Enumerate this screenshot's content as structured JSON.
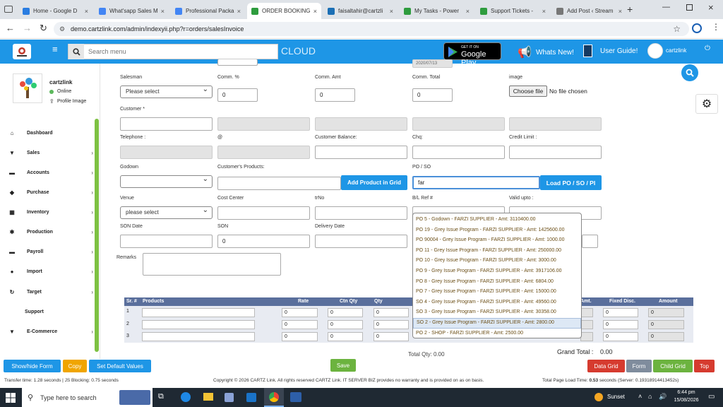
{
  "browser": {
    "tabs": [
      {
        "label": "Home - Google D",
        "color": "#2a7de1"
      },
      {
        "label": "What'sapp Sales M",
        "color": "#4285f4"
      },
      {
        "label": "Professional Packa",
        "color": "#4285f4"
      },
      {
        "label": "ORDER BOOKING",
        "color": "#2e9c3e"
      },
      {
        "label": "faisaltahir@cartzli",
        "color": "#1b6fb5"
      },
      {
        "label": "My Tasks - Power",
        "color": "#2e9c3e"
      },
      {
        "label": "Support Tickets -",
        "color": "#2e9c3e"
      },
      {
        "label": "Add Post ‹ Stream",
        "color": "#555"
      }
    ],
    "url": "demo.cartzlink.com/admin/indexyii.php?r=orders/salesInvoice"
  },
  "header": {
    "search_placeholder": "Search menu",
    "cloud_label": "CLOUD",
    "google_play_small": "GET IT ON",
    "google_play_big": "Google Play",
    "whats_new": "Whats New!",
    "user_guide": "User Guide!",
    "user_name": "cartzlink"
  },
  "sidebar": {
    "user_name": "cartzlink",
    "status": "Online",
    "profile_image": "Profile Image",
    "items": [
      {
        "label": "Dashboard",
        "icon": "home-icon",
        "glyph": "⌂",
        "chevron": false
      },
      {
        "label": "Sales",
        "icon": "cart-icon",
        "glyph": "🛒",
        "chevron": true
      },
      {
        "label": "Accounts",
        "icon": "bank-icon",
        "glyph": "▬",
        "chevron": true
      },
      {
        "label": "Purchase",
        "icon": "tag-icon",
        "glyph": "◆",
        "chevron": true
      },
      {
        "label": "Inventory",
        "icon": "grid-icon",
        "glyph": "▦",
        "chevron": true
      },
      {
        "label": "Production",
        "icon": "gear-icon",
        "glyph": "✱",
        "chevron": true
      },
      {
        "label": "Payroll",
        "icon": "bank-icon",
        "glyph": "▬",
        "chevron": true
      },
      {
        "label": "Import",
        "icon": "user-icon",
        "glyph": "●",
        "chevron": true
      },
      {
        "label": "Target",
        "icon": "refresh-icon",
        "glyph": "↻",
        "chevron": true
      },
      {
        "label": "Support",
        "icon": "",
        "glyph": "",
        "chevron": false
      },
      {
        "label": "E-Commerce",
        "icon": "cart-icon",
        "glyph": "🛒",
        "chevron": true
      }
    ]
  },
  "form": {
    "partial_date": "2020/07/13",
    "salesman_label": "Salesman",
    "salesman_value": "Please select",
    "comm_pct_label": "Comm. %",
    "comm_pct_value": "0",
    "comm_amt_label": "Comm. Amt",
    "comm_amt_value": "0",
    "comm_total_label": "Comm. Total",
    "comm_total_value": "0",
    "image_label": "image",
    "choose_file": "Choose file",
    "no_file": "No file chosen",
    "customer_label": "Customer *",
    "telephone_label": "Telephone :",
    "at_label": "@",
    "customer_balance_label": "Customer Balance:",
    "chq_label": "Chq:",
    "credit_limit_label": "Credit Limit :",
    "godown_label": "Godown",
    "customers_products_label": "Customer's Products:",
    "add_product_btn": "Add Product in Grid",
    "po_so_label": "PO / SO",
    "po_so_value": "far",
    "load_po_btn": "Load PO / SO / PI",
    "venue_label": "Venue",
    "venue_value": "please select",
    "cost_center_label": "Cost Center",
    "trno_label": "trNo",
    "bl_ref_label": "B/L Ref #",
    "valid_upto_label": "Valid upto :",
    "son_date_label": "SON Date",
    "son_label": "SON",
    "son_value": "0",
    "delivery_date_label": "Delivery Date",
    "remarks_label": "Remarks"
  },
  "po_dropdown": [
    "PO 5 - Godown - FARZI SUPPLIER - Amt: 3110400.00",
    "PO 19 - Grey Issue Program - FARZI SUPPLIER - Amt: 1425600.00",
    "PO 90004 - Grey Issue Program - FARZI SUPPLIER - Amt: 1000.00",
    "PO 11 - Grey Issue Program - FARZI SUPPLIER - Amt: 250000.00",
    "PO 10 - Grey Issue Program - FARZI SUPPLIER - Amt: 3000.00",
    "PO 9 - Grey Issue Program - FARZI SUPPLIER - Amt: 3917106.00",
    "PO 8 - Grey Issue Program - FARZI SUPPLIER - Amt: 6804.00",
    "PO 7 - Grey Issue Program - FARZI SUPPLIER - Amt: 15000.00",
    "SO 4 - Grey Issue Program - FARZI SUPPLIER - Amt: 49560.00",
    "SO 3 - Grey Issue Program - FARZI SUPPLIER - Amt: 30358.00",
    "SO 2 - Grey Issue Program - FARZI SUPPLIER - Amt: 2800.00",
    "PO 2 - SHOP - FARZI SUPPLIER - Amt: 2500.00"
  ],
  "po_dropdown_highlight": 10,
  "grid": {
    "headers": {
      "sr": "Sr. #",
      "products": "Products",
      "rate": "Rate",
      "ctn_qty": "Ctn Qty",
      "qty": "Qty",
      "amt": "Amt.",
      "fixed_disc": "Fixed Disc.",
      "amount": "Amount"
    },
    "rows": [
      {
        "sr": "1",
        "rate": "0",
        "ctn": "0",
        "qty": "0",
        "disc": "0",
        "amount": "0"
      },
      {
        "sr": "2",
        "rate": "0",
        "ctn": "0",
        "qty": "0",
        "disc": "0",
        "amount": "0"
      },
      {
        "sr": "3",
        "rate": "0",
        "ctn": "0",
        "qty": "0",
        "disc": "0",
        "amount": "0"
      }
    ],
    "total_qty": "Total Qty: 0.00",
    "grand_total_label": "Grand Total :",
    "grand_total_value": "0.00"
  },
  "footer": {
    "show_hide": "Show/hide Form",
    "copy": "Copy",
    "set_default": "Set Default Values",
    "save": "Save",
    "data_grid": "Data Grid",
    "form": "Form",
    "child_grid": "Child Grid",
    "top": "Top"
  },
  "status": {
    "left": "Transfer time: 1.28 seconds | JS Blocking: 0.75 seconds",
    "center": "Copyright © 2026 CARTZ Link. All rights reserved CARTZ Link. IT SERVER BIZ provides no warranty and is provided on as on basis.",
    "right_prefix": "Total Page Load Time: ",
    "right_bold": "0.53",
    "right_suffix": " seconds (Server: 0.19318914413452s)"
  },
  "taskbar": {
    "search": "Type here to search",
    "weather": "Sunset",
    "time": "6:44 pm",
    "date": "15/08/2026"
  },
  "colors": {
    "header": "#1e96e6",
    "sidebar_accent": "#7dc142",
    "highlight": "#dde8f5"
  }
}
